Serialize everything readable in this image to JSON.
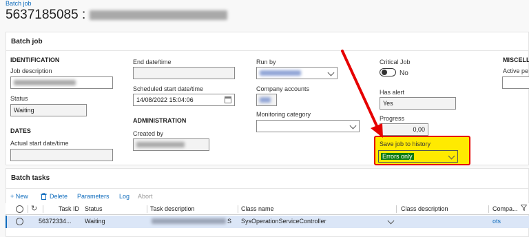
{
  "breadcrumb": "Batch job",
  "title": {
    "id": "5637185085 :"
  },
  "batch_job_card": {
    "title": "Batch job",
    "identification": {
      "heading": "IDENTIFICATION",
      "job_description_label": "Job description",
      "status_label": "Status",
      "status_value": "Waiting"
    },
    "dates": {
      "heading": "DATES",
      "actual_start_label": "Actual start date/time",
      "actual_start_value": ""
    },
    "schedule": {
      "end_label": "End date/time",
      "end_value": "",
      "scheduled_start_label": "Scheduled start date/time",
      "scheduled_start_value": "14/08/2022 15:04:06"
    },
    "administration": {
      "heading": "ADMINISTRATION",
      "created_by_label": "Created by"
    },
    "run_by": {
      "label": "Run by",
      "company_accounts_label": "Company accounts",
      "monitoring_label": "Monitoring category",
      "monitoring_value": ""
    },
    "critical": {
      "label": "Critical Job",
      "toggle_text": "No",
      "has_alert_label": "Has alert",
      "has_alert_value": "Yes",
      "progress_label": "Progress",
      "progress_value": "0,00",
      "save_history_label": "Save job to history",
      "save_history_value": "Errors only"
    },
    "misc": {
      "heading": "MISCELL",
      "active_label": "Active pe"
    }
  },
  "batch_tasks": {
    "title": "Batch tasks",
    "toolbar": {
      "new": "+ New",
      "delete": "Delete",
      "parameters": "Parameters",
      "log": "Log",
      "abort": "Abort"
    },
    "columns": {
      "task_id": "Task ID",
      "status": "Status",
      "task_description": "Task description",
      "class_name": "Class name",
      "class_description": "Class description",
      "company": "Compa..."
    },
    "rows": [
      {
        "task_id": "56372334...",
        "status": "Waiting",
        "task_description_suffix": "S",
        "class_name": "SysOperationServiceController",
        "class_description": "",
        "company": "ots"
      }
    ]
  },
  "icons": {
    "delete": "trash-icon",
    "filter": "filter-icon",
    "refresh": "refresh-icon",
    "calendar": "calendar-icon",
    "dropdown": "chevron-down-icon"
  },
  "colors": {
    "link": "#0f6cbd",
    "annotation_arrow": "#e60000",
    "annotation_highlight": "#ffea00",
    "selected_option": "#107c10"
  }
}
